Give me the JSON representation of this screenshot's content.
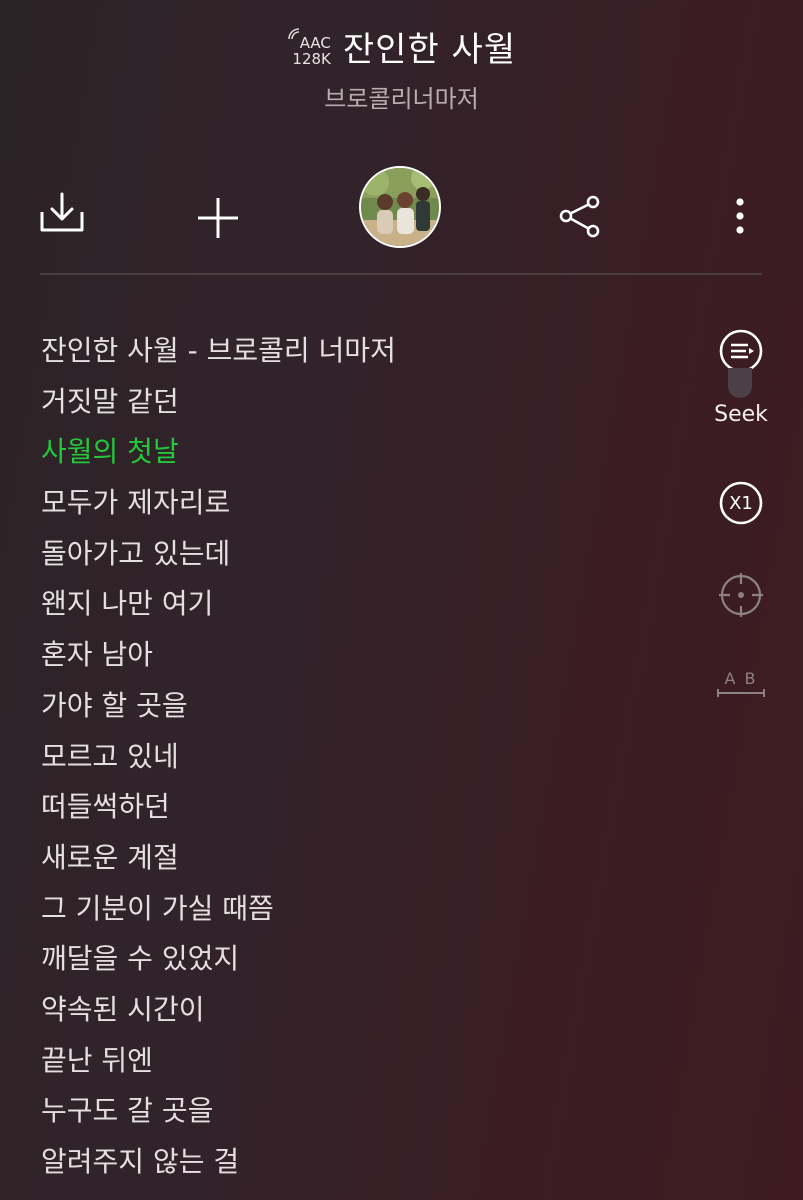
{
  "header": {
    "codec_format": "AAC",
    "codec_bitrate": "128K",
    "title": "잔인한 사월",
    "artist": "브로콜리너마저"
  },
  "toolbar": {
    "icons": [
      "download-icon",
      "add-icon",
      "album-art",
      "share-icon",
      "more-icon"
    ]
  },
  "side_controls": {
    "seek_label": "Seek",
    "speed_label": "X1",
    "ab_label": "A B"
  },
  "lyrics": [
    "잔인한 사월 - 브로콜리 너마저",
    "거짓말 같던",
    "사월의 첫날",
    "모두가 제자리로",
    "돌아가고 있는데",
    "왠지 나만 여기",
    "혼자 남아",
    "가야 할 곳을",
    "모르고 있네",
    "떠들썩하던",
    "새로운 계절",
    "그 기분이 가실 때쯤",
    "깨달을 수 있었지",
    "약속된 시간이",
    "끝난 뒤엔",
    "누구도 갈 곳을",
    "알려주지 않는 걸"
  ],
  "active_lyric_index": 2,
  "colors": {
    "active_lyric": "#22c93a",
    "text": "#e4e0e1",
    "background_start": "#2c2326",
    "background_end": "#3f1b21"
  }
}
